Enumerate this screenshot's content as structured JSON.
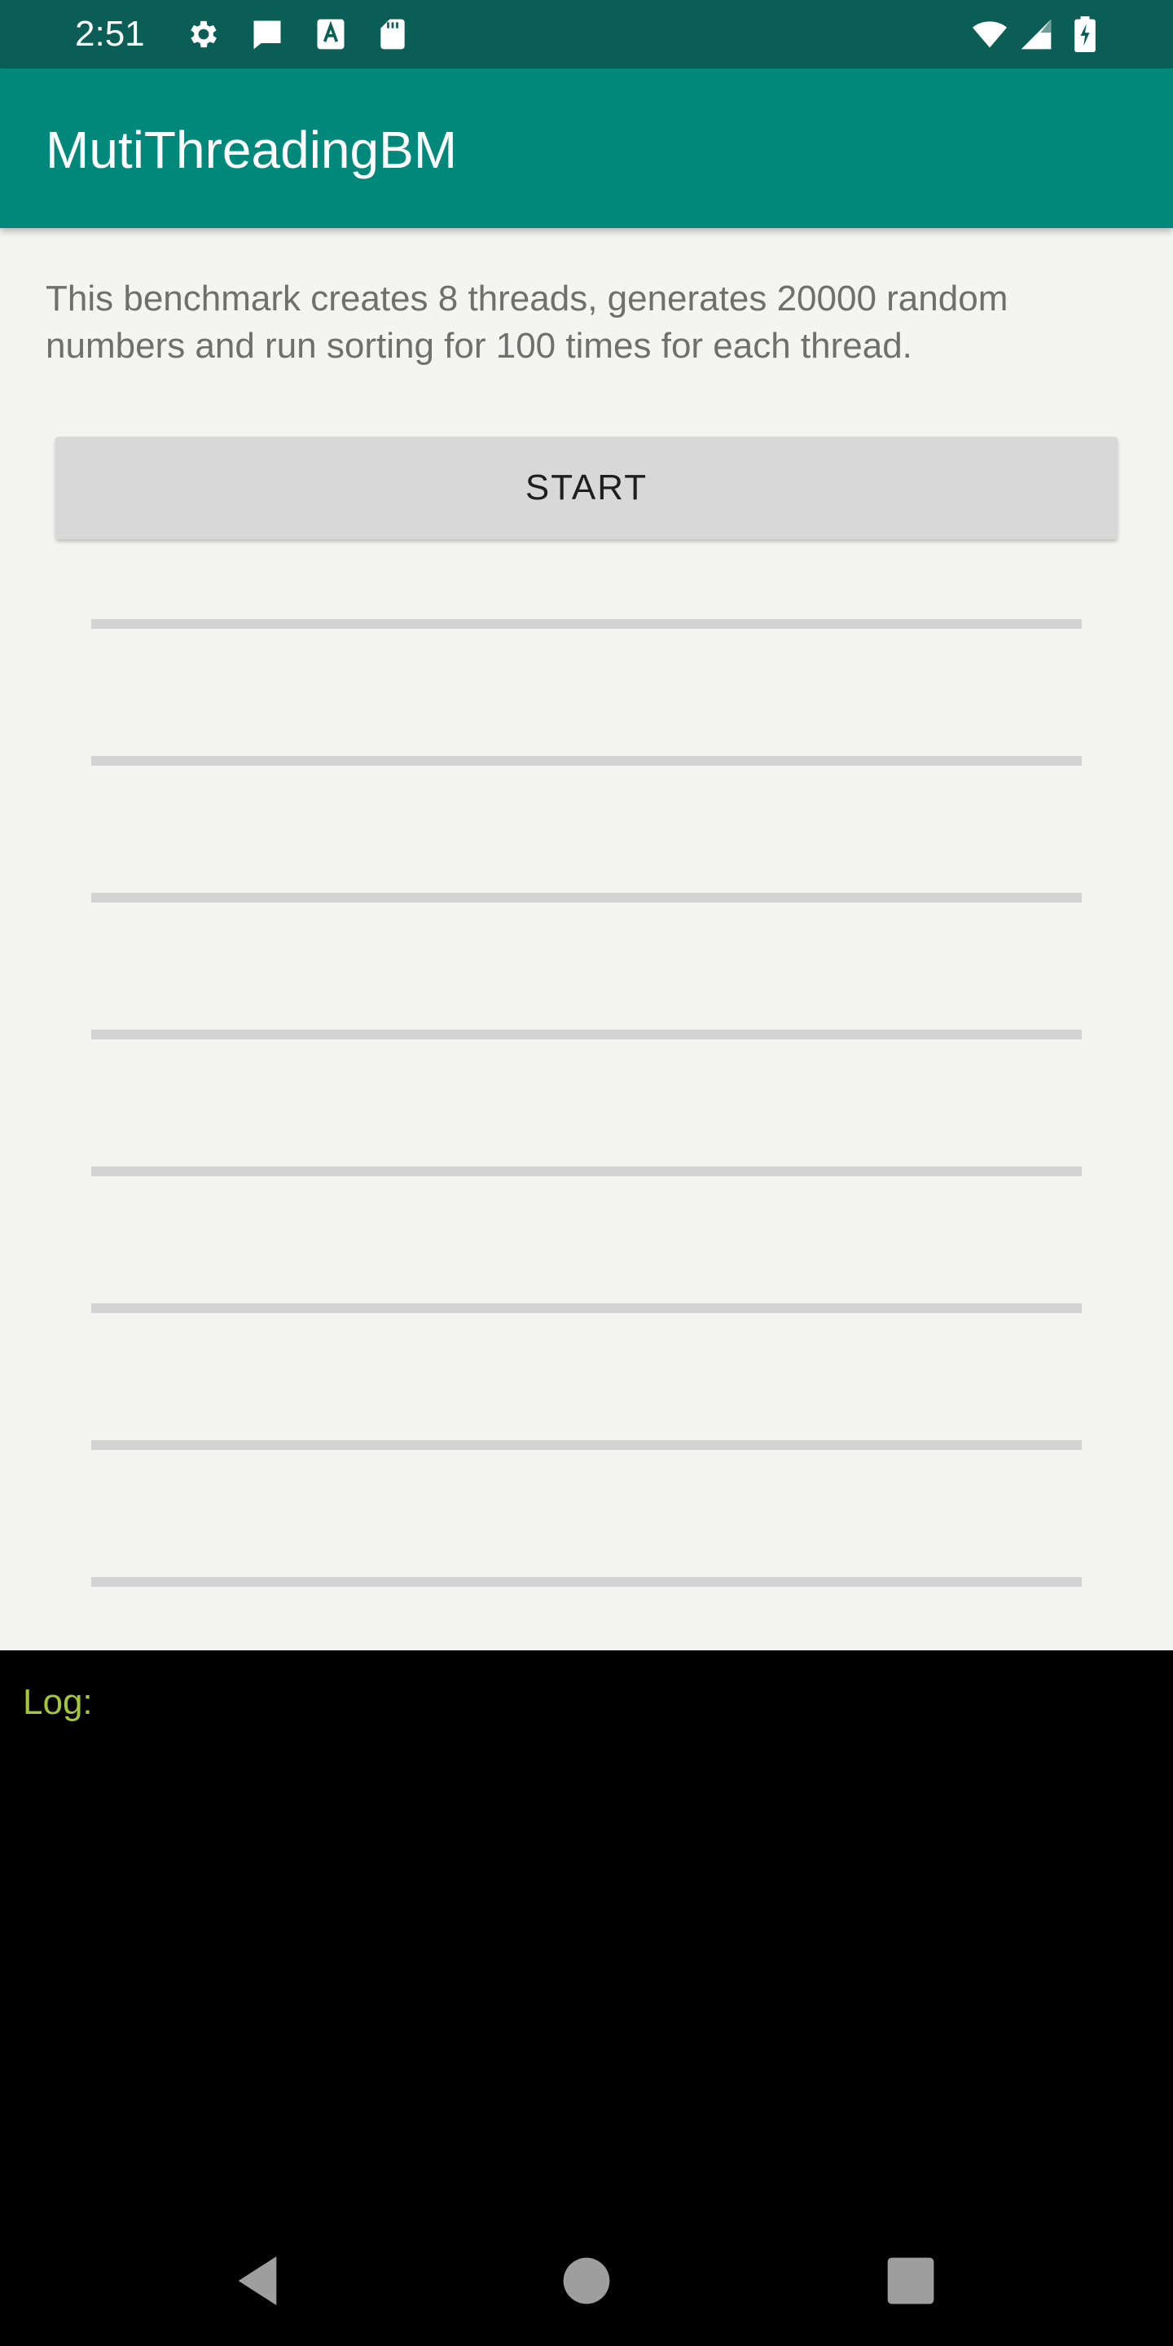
{
  "status_bar": {
    "time": "2:51",
    "left_icons": [
      "settings-icon",
      "message-icon",
      "a-notification-icon",
      "sd-card-icon"
    ],
    "right_icons": [
      "wifi-icon",
      "cell-signal-icon",
      "battery-charging-icon"
    ]
  },
  "app_bar": {
    "title": "MutiThreadingBM"
  },
  "main": {
    "description": "This benchmark creates 8 threads, generates 20000 random numbers and run sorting for 100 times for each thread.",
    "start_label": "START",
    "thread_progress": [
      0,
      0,
      0,
      0,
      0,
      0,
      0,
      0
    ]
  },
  "log": {
    "label": "Log:"
  },
  "nav_bar": {
    "icons": [
      "back-icon",
      "home-icon",
      "recents-icon"
    ]
  },
  "colors": {
    "status_bar": "#0b5e55",
    "app_bar": "#00897b",
    "log_text": "#a4c639",
    "progress_track": "#d3d3d3"
  }
}
